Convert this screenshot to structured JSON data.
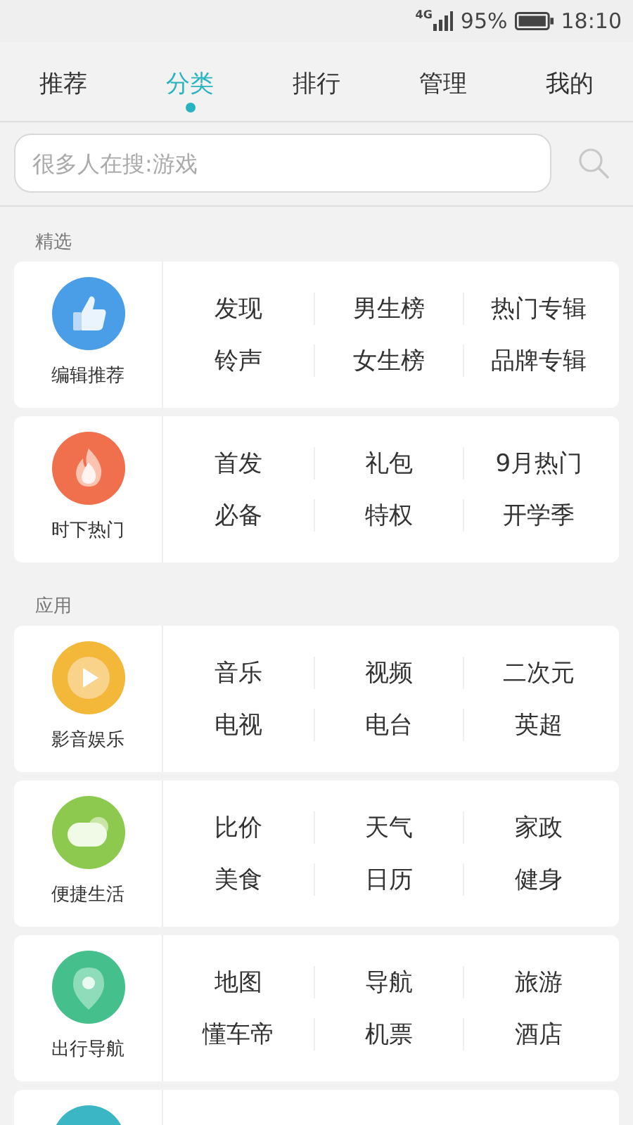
{
  "status_bar": {
    "network": "4G",
    "battery": "95%",
    "time": "18:10"
  },
  "tabs": [
    {
      "label": "推荐",
      "selected": false
    },
    {
      "label": "分类",
      "selected": true
    },
    {
      "label": "排行",
      "selected": false
    },
    {
      "label": "管理",
      "selected": false
    },
    {
      "label": "我的",
      "selected": false
    }
  ],
  "search": {
    "placeholder": "很多人在搜:游戏"
  },
  "sections": [
    {
      "title": "精选",
      "cards": [
        {
          "kind": "thumb",
          "color": "#4a9ee8",
          "label": "编辑推荐",
          "links": [
            "发现",
            "男生榜",
            "热门专辑",
            "铃声",
            "女生榜",
            "品牌专辑"
          ]
        },
        {
          "kind": "flame",
          "color": "#f0704e",
          "label": "时下热门",
          "links": [
            "首发",
            "礼包",
            "9月热门",
            "必备",
            "特权",
            "开学季"
          ]
        }
      ]
    },
    {
      "title": "应用",
      "cards": [
        {
          "kind": "play",
          "color": "#f3b73a",
          "label": "影音娱乐",
          "links": [
            "音乐",
            "视频",
            "二次元",
            "电视",
            "电台",
            "英超"
          ]
        },
        {
          "kind": "cloud",
          "color": "#8cc94e",
          "label": "便捷生活",
          "links": [
            "比价",
            "天气",
            "家政",
            "美食",
            "日历",
            "健身"
          ]
        },
        {
          "kind": "pin",
          "color": "#45c08d",
          "label": "出行导航",
          "links": [
            "地图",
            "导航",
            "旅游",
            "懂车帝",
            "机票",
            "酒店"
          ]
        },
        {
          "kind": "circle",
          "color": "#3bb6c4"
        }
      ]
    }
  ]
}
